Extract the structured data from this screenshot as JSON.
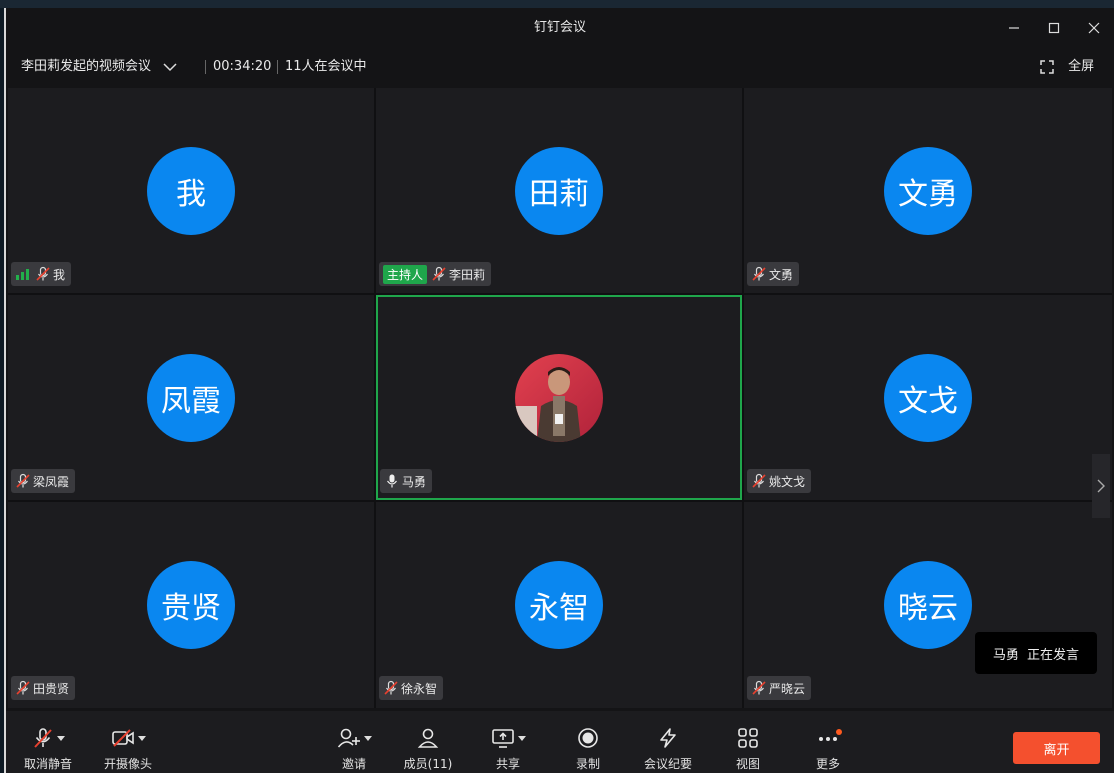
{
  "window": {
    "title": "钉钉会议",
    "controls": [
      "minimize-icon",
      "maximize-icon",
      "close-icon"
    ]
  },
  "info": {
    "meeting_name": "李田莉发起的视频会议",
    "duration": "00:34:20",
    "participants_text": "11人在会议中",
    "fullscreen_label": "全屏"
  },
  "tiles": [
    {
      "avatar": "我",
      "name": "我",
      "signal": true,
      "host": false,
      "mic": "off"
    },
    {
      "avatar": "田莉",
      "name": "李田莉",
      "signal": false,
      "host": true,
      "mic": "off"
    },
    {
      "avatar": "文勇",
      "name": "文勇",
      "signal": false,
      "host": false,
      "mic": "off"
    },
    {
      "avatar": "凤霞",
      "name": "梁凤霞",
      "signal": false,
      "host": false,
      "mic": "off"
    },
    {
      "avatar": "",
      "name": "马勇",
      "signal": false,
      "host": false,
      "mic": "on",
      "photo": true,
      "active": true
    },
    {
      "avatar": "文戈",
      "name": "姚文戈",
      "signal": false,
      "host": false,
      "mic": "off"
    },
    {
      "avatar": "贵贤",
      "name": "田贵贤",
      "signal": false,
      "host": false,
      "mic": "off"
    },
    {
      "avatar": "永智",
      "name": "徐永智",
      "signal": false,
      "host": false,
      "mic": "off"
    },
    {
      "avatar": "晓云",
      "name": "严晓云",
      "signal": false,
      "host": false,
      "mic": "off"
    }
  ],
  "host_label": "主持人",
  "speaking": {
    "name": "马勇",
    "status": "正在发言"
  },
  "toolbar": {
    "unmute": "取消静音",
    "camera": "开摄像头",
    "invite": "邀请",
    "members": "成员(11)",
    "share": "共享",
    "record": "录制",
    "minutes": "会议纪要",
    "view": "视图",
    "more": "更多",
    "leave": "离开"
  },
  "colors": {
    "avatar": "#0a87f0",
    "host": "#1fa64b",
    "active_border": "#1fa64b",
    "leave": "#f4502e"
  }
}
